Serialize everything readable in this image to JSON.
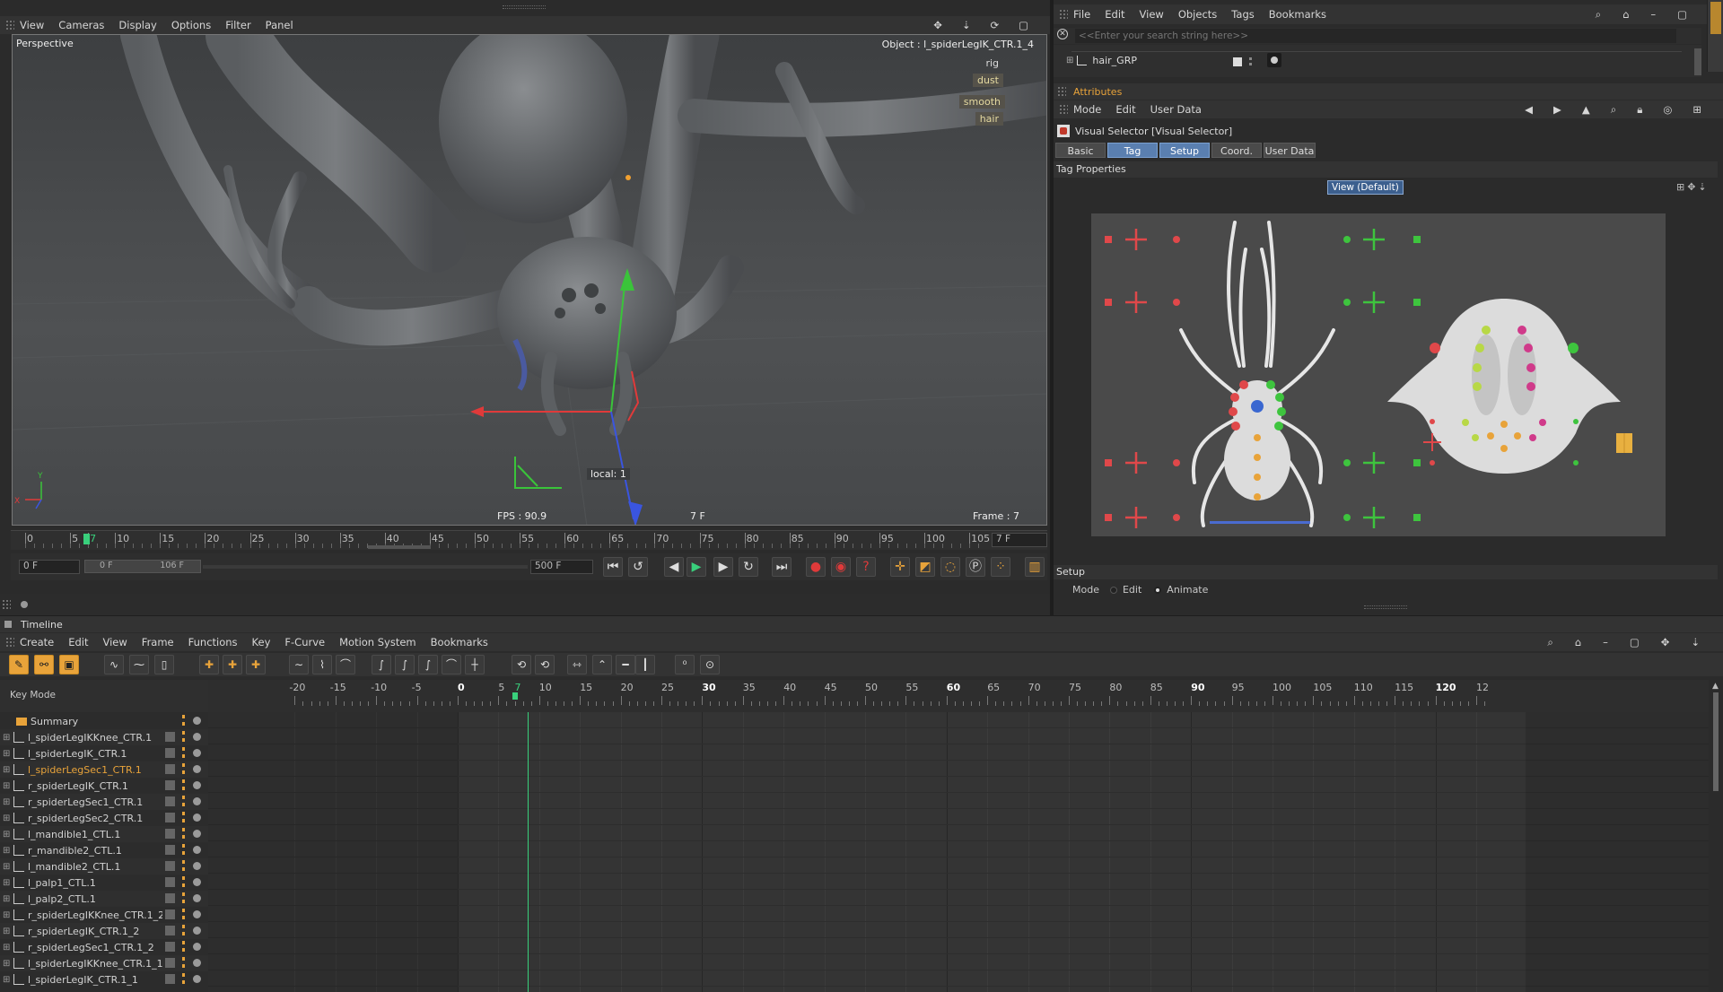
{
  "viewport_menu": [
    "View",
    "Cameras",
    "Display",
    "Options",
    "Filter",
    "Panel"
  ],
  "viewport": {
    "camera": "Perspective",
    "object_label": "Object : l_spiderLegIK_CTR.1_4",
    "layer_tags": [
      "rig",
      "dust",
      "smooth",
      "hair"
    ],
    "local_label": "local: 1",
    "fps": "FPS : 90.9",
    "current_frame_center": "7 F",
    "frame_readout": "Frame : 7"
  },
  "playback": {
    "ruler_ticks": [
      "0",
      "5",
      "7",
      "10",
      "15",
      "20",
      "25",
      "30",
      "35",
      "40",
      "45",
      "50",
      "55",
      "60",
      "65",
      "70",
      "75",
      "80",
      "85",
      "90",
      "95",
      "100",
      "105"
    ],
    "frame_field": "7 F",
    "start_field": "0 F",
    "range_start": "0 F",
    "range_end": "106 F",
    "end_field": "500 F",
    "current_frame": 7,
    "max_frame": 106
  },
  "object_manager": {
    "menu": [
      "File",
      "Edit",
      "View",
      "Objects",
      "Tags",
      "Bookmarks"
    ],
    "search_placeholder": "<<Enter your search string here>>",
    "visible_object": "hair_GRP"
  },
  "attributes": {
    "panel_title": "Attributes",
    "menu": [
      "Mode",
      "Edit",
      "User Data"
    ],
    "object_title": "Visual Selector [Visual Selector]",
    "tabs": [
      "Basic",
      "Tag",
      "Setup",
      "Coord.",
      "User Data"
    ],
    "active_tabs": [
      "Tag",
      "Setup"
    ],
    "section": "Tag Properties",
    "view_button": "View (Default)",
    "setup_section": "Setup",
    "mode_label": "Mode",
    "mode_options": [
      "Edit",
      "Animate"
    ],
    "mode_selected": "Animate"
  },
  "timeline": {
    "title": "Timeline",
    "menu": [
      "Create",
      "Edit",
      "View",
      "Frame",
      "Functions",
      "Key",
      "F-Curve",
      "Motion System",
      "Bookmarks"
    ],
    "key_mode_label": "Key Mode",
    "ruler_ticks": [
      "-20",
      "-15",
      "-10",
      "-5",
      "0",
      "5",
      "7",
      "10",
      "15",
      "20",
      "25",
      "30",
      "35",
      "40",
      "45",
      "50",
      "55",
      "60",
      "65",
      "70",
      "75",
      "80",
      "85",
      "90",
      "95",
      "100",
      "105",
      "110",
      "115",
      "120",
      "12"
    ],
    "tracks": [
      {
        "name": "Summary",
        "highlight": false,
        "folder": true
      },
      {
        "name": "l_spiderLegIKKnee_CTR.1",
        "highlight": false
      },
      {
        "name": "l_spiderLegIK_CTR.1",
        "highlight": false
      },
      {
        "name": "l_spiderLegSec1_CTR.1",
        "highlight": true
      },
      {
        "name": "r_spiderLegIK_CTR.1",
        "highlight": false
      },
      {
        "name": "r_spiderLegSec1_CTR.1",
        "highlight": false
      },
      {
        "name": "r_spiderLegSec2_CTR.1",
        "highlight": false
      },
      {
        "name": "l_mandible1_CTL.1",
        "highlight": false
      },
      {
        "name": "r_mandible2_CTL.1",
        "highlight": false
      },
      {
        "name": "l_mandible2_CTL.1",
        "highlight": false
      },
      {
        "name": "l_palp1_CTL.1",
        "highlight": false
      },
      {
        "name": "l_palp2_CTL.1",
        "highlight": false
      },
      {
        "name": "r_spiderLegIKKnee_CTR.1_2",
        "highlight": false
      },
      {
        "name": "r_spiderLegIK_CTR.1_2",
        "highlight": false
      },
      {
        "name": "r_spiderLegSec1_CTR.1_2",
        "highlight": false
      },
      {
        "name": "l_spiderLegIKKnee_CTR.1_1",
        "highlight": false
      },
      {
        "name": "l_spiderLegIK_CTR.1_1",
        "highlight": false
      }
    ]
  },
  "colors": {
    "accent_orange": "#e8a33a",
    "active_tab": "#5a7fb0",
    "selector_red": "#e0484a",
    "selector_green": "#3ec43e",
    "playhead_green": "#39d07c"
  }
}
